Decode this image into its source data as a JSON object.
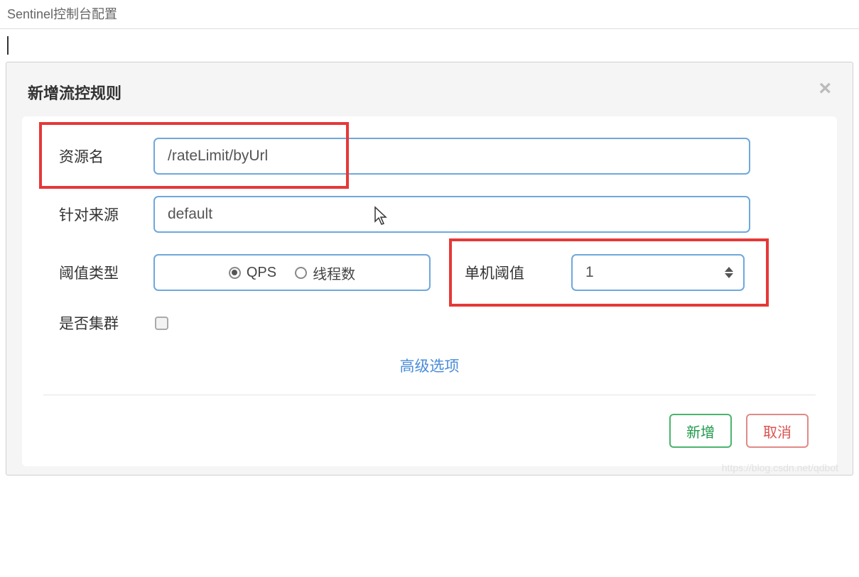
{
  "header": {
    "title": "Sentinel控制台配置"
  },
  "dialog": {
    "title": "新增流控规则",
    "form": {
      "resource_label": "资源名",
      "resource_value": "/rateLimit/byUrl",
      "source_label": "针对来源",
      "source_value": "default",
      "threshold_type_label": "阈值类型",
      "radio_qps": "QPS",
      "radio_threads": "线程数",
      "single_threshold_label": "单机阈值",
      "single_threshold_value": "1",
      "cluster_label": "是否集群",
      "advanced_options": "高级选项"
    },
    "footer": {
      "submit": "新增",
      "cancel": "取消"
    }
  },
  "watermark": "https://blog.csdn.net/qdbot"
}
